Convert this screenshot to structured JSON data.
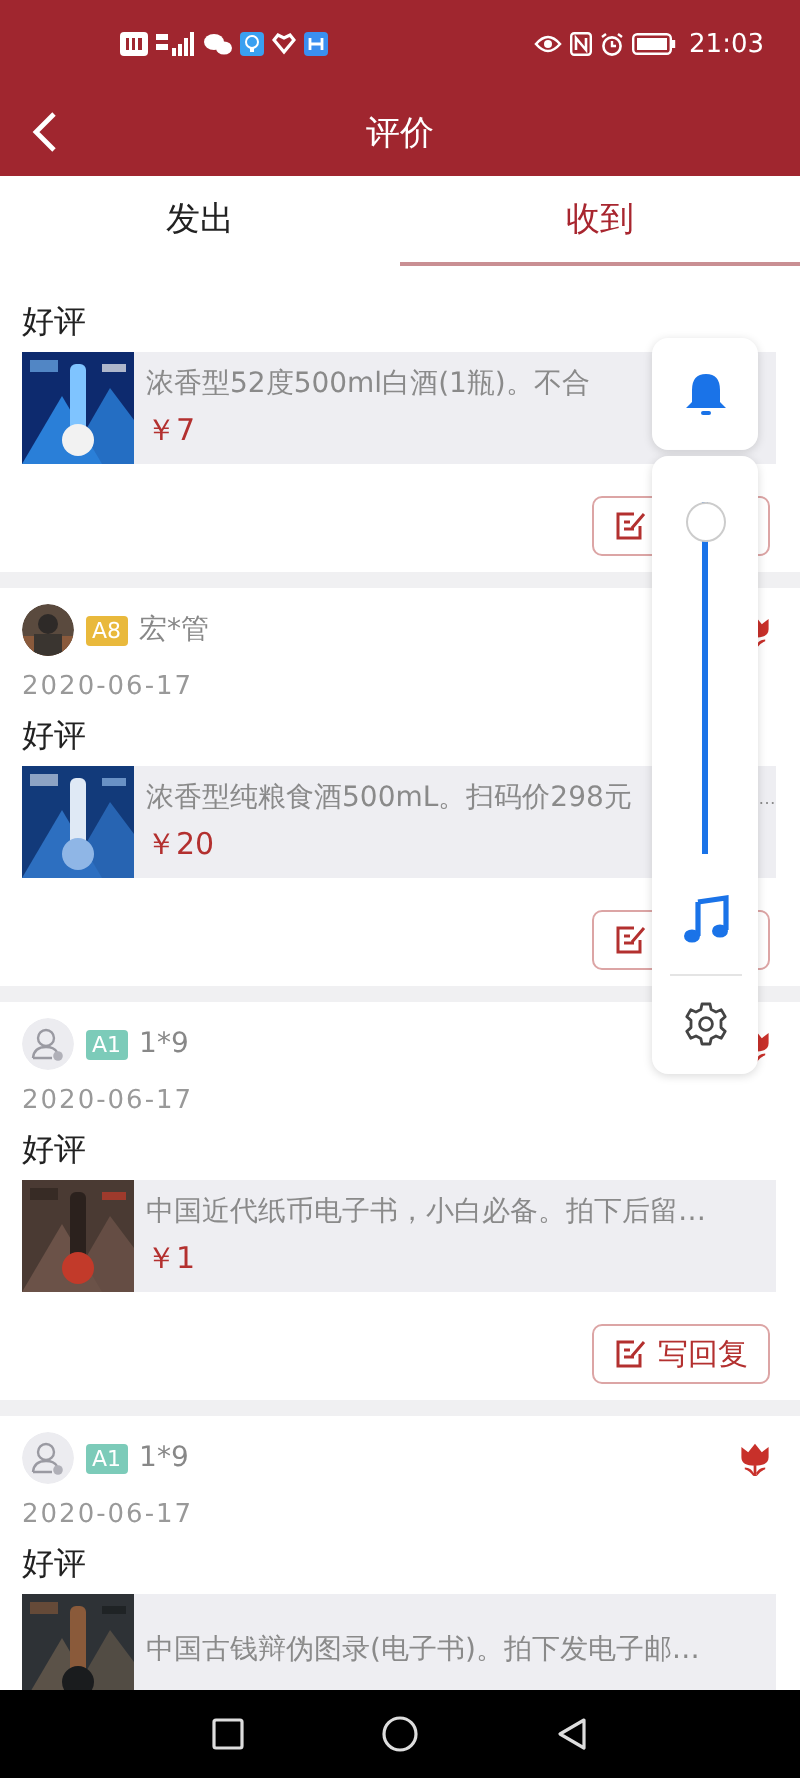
{
  "status_bar": {
    "time": "21:03"
  },
  "header": {
    "title": "评价"
  },
  "tabs": [
    {
      "label": "发出",
      "selected": false
    },
    {
      "label": "收到",
      "selected": true
    }
  ],
  "reviews": [
    {
      "rating": "好评",
      "product": {
        "title": "浓香型52度500ml白酒(1瓶)。不合",
        "price": "￥7"
      },
      "reply_button": {
        "kind": "covered"
      }
    },
    {
      "user": {
        "level": "A8",
        "color": "#e9b93c",
        "name": "宏*管"
      },
      "date": "2020-06-17",
      "rating": "好评",
      "product": {
        "title": "浓香型纯粮食酒500mL。扫码价298元",
        "tail": "…",
        "price": "￥20"
      },
      "reply_button": {
        "kind": "covered"
      }
    },
    {
      "user": {
        "avatar": {
          "kind": "default"
        },
        "level": "A1",
        "color": "#7ccbb9",
        "name": "1*9"
      },
      "date": "2020-06-17",
      "rating": "好评",
      "product": {
        "title": "中国近代纸币电子书，小白必备。拍下后留…",
        "price": "￥1"
      },
      "reply_button": {
        "kind": "full",
        "label": "写回复"
      }
    },
    {
      "user": {
        "avatar": {
          "kind": "default"
        },
        "level": "A1",
        "color": "#7ccbb9",
        "name": "1*9"
      },
      "date": "2020-06-17",
      "rating": "好评",
      "product": {
        "title": "中国古钱辩伪图录(电子书)。拍下发电子邮…"
      }
    }
  ],
  "volume_panel": {
    "level": 1
  }
}
